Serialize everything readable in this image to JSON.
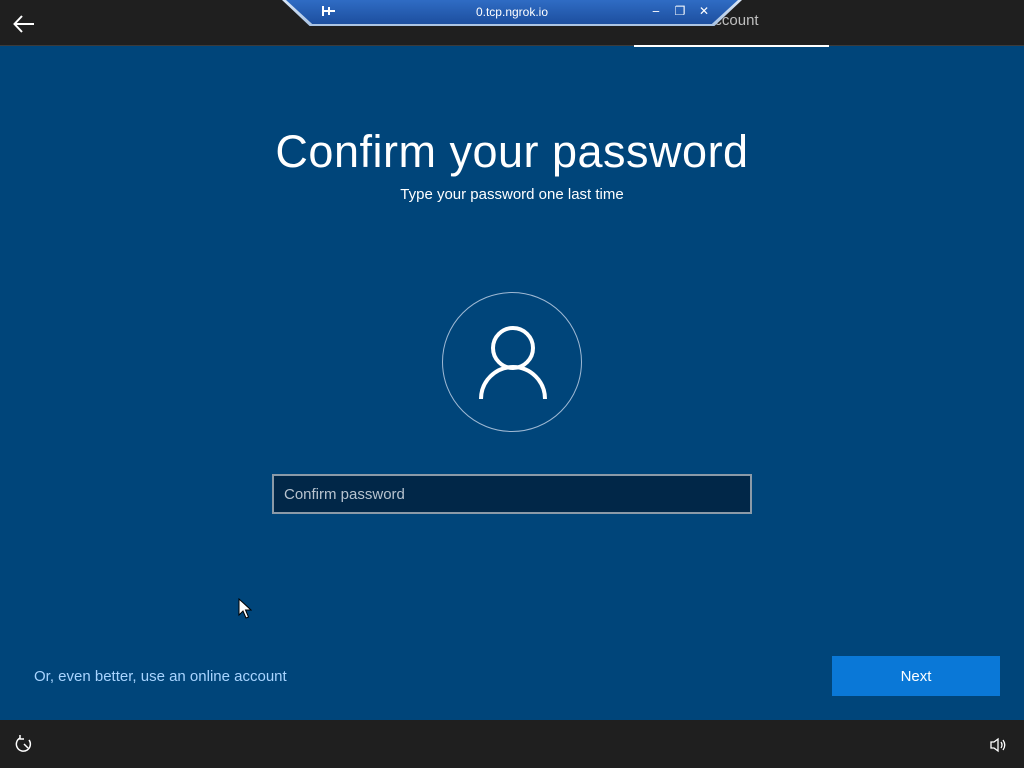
{
  "top_bar": {
    "active_tab": "Account"
  },
  "remote_session": {
    "title": "0.tcp.ngrok.io",
    "pin_icon": "pin-icon",
    "controls": [
      "minimize-icon",
      "restore-icon",
      "close-icon"
    ],
    "minimize_glyph": "‒",
    "restore_glyph": "❐",
    "close_glyph": "✕"
  },
  "main": {
    "title": "Confirm your password",
    "subtitle": "Type your password one last time",
    "avatar_icon": "user-icon",
    "password_field": {
      "value": "",
      "placeholder": "Confirm password"
    }
  },
  "footer": {
    "online_account_link": "Or, even better, use an online account",
    "next_label": "Next"
  },
  "bottom_bar": {
    "ease_of_access_icon": "ease-of-access-icon",
    "volume_icon": "volume-icon"
  },
  "colors": {
    "background": "#00457a",
    "bars": "#1f1f1f",
    "accent_button": "#0a78d7",
    "link": "#a8d4ff"
  }
}
